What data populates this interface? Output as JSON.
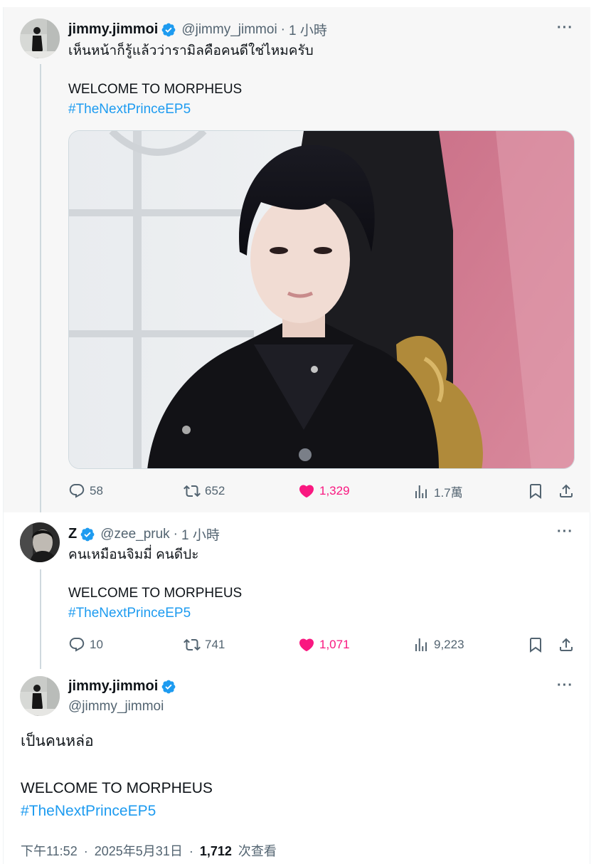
{
  "colors": {
    "link": "#1d9bf0",
    "like": "#f91880",
    "muted": "#536471",
    "verified": "#1d9bf0"
  },
  "tweets": [
    {
      "name": "jimmy.jimmoi",
      "handle": "@jimmy_jimmoi",
      "separator": "·",
      "time": "1 小時",
      "line1": "เห็นหน้าก็รู้แล้วว่ารามิลคือคนดีใช่ไหมครับ",
      "line2": "WELCOME TO MORPHEUS",
      "hashtag": "#TheNextPrinceEP5",
      "replies": "58",
      "reposts": "652",
      "likes": "1,329",
      "views": "1.7萬"
    },
    {
      "name": "Z",
      "handle": "@zee_pruk",
      "separator": "·",
      "time": "1 小時",
      "line1": "คนเหมือนจิมมี่ คนดีปะ",
      "line2": "WELCOME TO MORPHEUS",
      "hashtag": "#TheNextPrinceEP5",
      "replies": "10",
      "reposts": "741",
      "likes": "1,071",
      "views": "9,223"
    }
  ],
  "main_tweet": {
    "name": "jimmy.jimmoi",
    "handle": "@jimmy_jimmoi",
    "line1": "เป็นคนหล่อ",
    "line2": "WELCOME TO MORPHEUS",
    "hashtag": "#TheNextPrinceEP5",
    "time": "下午11:52",
    "separator": "·",
    "date": "2025年5月31日",
    "view_count": "1,712",
    "view_label": "次查看"
  },
  "icons": {
    "more": "more-icon",
    "reply": "reply-icon",
    "repost": "repost-icon",
    "like": "heart-icon",
    "views": "views-icon",
    "bookmark": "bookmark-icon",
    "share": "share-icon",
    "verified": "verified-badge-icon"
  },
  "more_label": "···"
}
